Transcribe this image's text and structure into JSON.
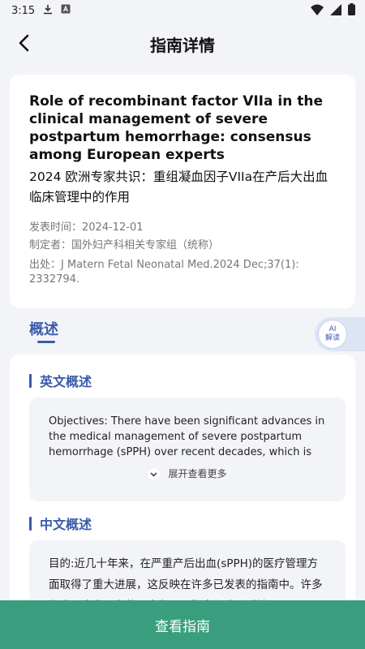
{
  "status_bar": {
    "time": "3:15",
    "icons": [
      "download-icon",
      "notification-a-icon",
      "wifi-icon",
      "signal-icon",
      "battery-icon"
    ]
  },
  "header": {
    "back_icon": "chevron-left-icon",
    "title": "指南详情"
  },
  "guideline": {
    "title_en": "Role of recombinant factor VIIa in the clinical management of severe postpartum hemorrhage: consensus among European experts",
    "title_cn": "2024 欧洲专家共识：重组凝血因子VIIa在产后大出血临床管理中的作用",
    "publish_date": "发表时间：2024-12-01",
    "author": "制定者：国外妇产科相关专家组（统称）",
    "source": "出处：J Matern Fetal Neonatal Med.2024 Dec;37(1): 2332794."
  },
  "tabs": {
    "overview": "概述"
  },
  "ai_button": {
    "line1": "AI",
    "line2": "解读"
  },
  "summary": {
    "en_title": "英文概述",
    "en_text": "Objectives: There have been significant advances in the medical management of severe postpartum hemorrhage (sPPH) over recent decades, which is refl…",
    "expand_label": "展开查看更多",
    "cn_title": "中文概述",
    "cn_text": "目的:近几十年来，在严重产后出血(sPPH)的医疗管理方面取得了重大进展，这反映在许多已发表的指南中。许多为止，许多现有的国家和国际指南都建议采纳rFVIIa"
  },
  "bottom_button": {
    "label": "查看指南"
  },
  "colors": {
    "accent_blue": "#3b5aa8",
    "button_green": "#3a9e7e",
    "background": "#f3f4f8"
  }
}
